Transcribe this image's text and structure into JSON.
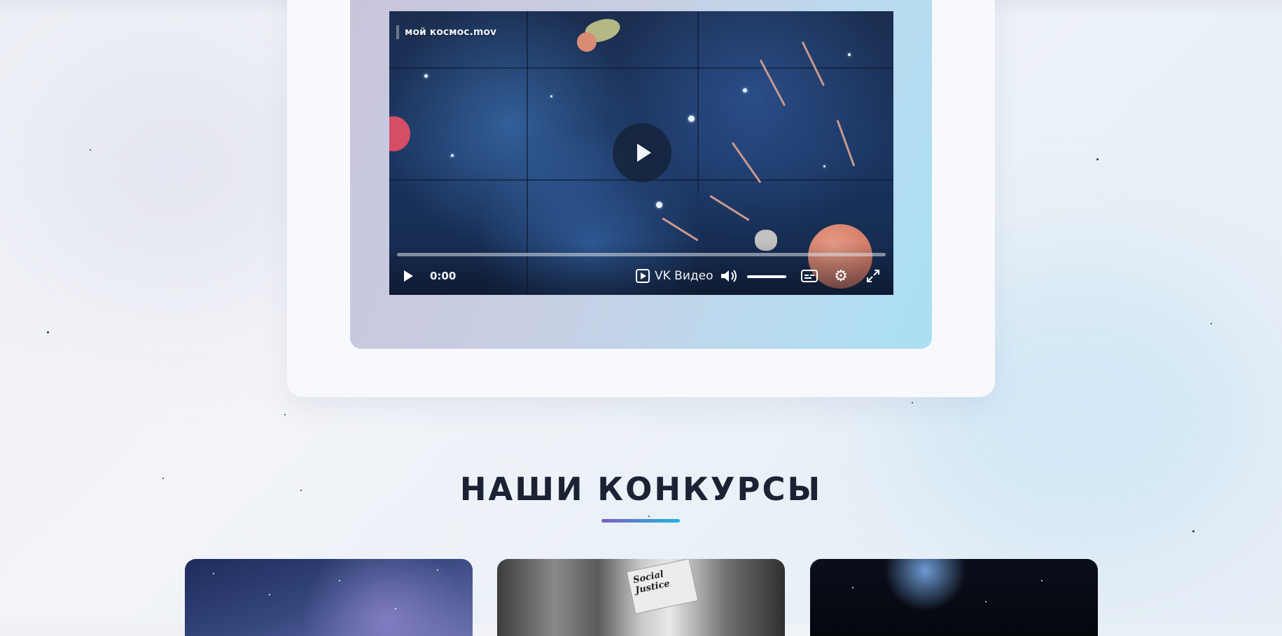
{
  "video": {
    "title": "мой космос.mov",
    "time": "0:00",
    "brand": "VK Видео",
    "progress": 0.0,
    "volume": 1.0
  },
  "icons": {
    "play": "play-icon",
    "volume": "volume-icon",
    "subtitles": "subtitles-icon",
    "settings": "gear-icon",
    "fullscreen": "fullscreen-icon",
    "brand_logo": "vk-video-logo-icon"
  },
  "section": {
    "title": "НАШИ КОНКУРСЫ"
  },
  "contests": [
    {
      "image": "starry-sky-image"
    },
    {
      "image": "newspaper-image",
      "paper_text": "Social Justice"
    },
    {
      "image": "night-sky-image"
    }
  ],
  "colors": {
    "title": "#1c2233",
    "accent_start": "#7b5fc4",
    "accent_end": "#1fb4e6"
  }
}
